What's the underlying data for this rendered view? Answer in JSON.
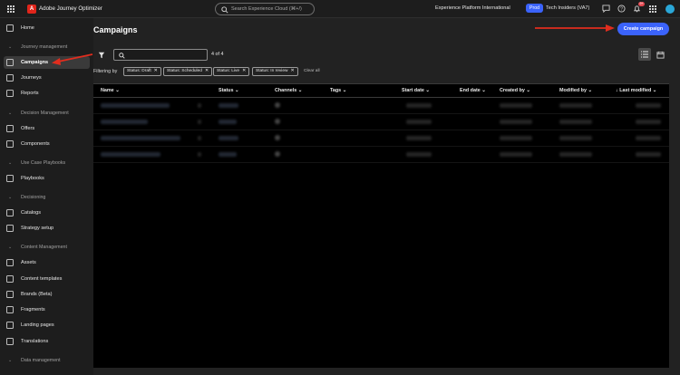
{
  "topbar": {
    "app_title": "Adobe Journey Optimizer",
    "search_placeholder": "Search Experience Cloud (⌘+/)",
    "org": "Experience Platform International",
    "env": "Prod",
    "tenant": "Tech Insiders (VA7)",
    "notification_count": "9+"
  },
  "sidebar": {
    "home": "Home",
    "sec_journey": "Journey management",
    "campaigns": "Campaigns",
    "journeys": "Journeys",
    "reports": "Reports",
    "sec_decision_mgmt": "Decision Management",
    "offers": "Offers",
    "components": "Components",
    "sec_playbooks": "Use Case Playbooks",
    "playbooks": "Playbooks",
    "sec_decisioning": "Decisioning",
    "catalogs": "Catalogs",
    "strategy": "Strategy setup",
    "sec_content": "Content Management",
    "assets": "Assets",
    "templates": "Content templates",
    "brands": "Brands (Beta)",
    "fragments": "Fragments",
    "landing": "Landing pages",
    "translations": "Translations",
    "sec_data": "Data management"
  },
  "main": {
    "title": "Campaigns",
    "create_button": "Create campaign",
    "result_count": "4 of 4",
    "filtering_by": "Filtering by",
    "filters": [
      "Status: Draft",
      "Status: Scheduled",
      "Status: Live",
      "Status: In review"
    ],
    "clear_all": "Clear all",
    "columns": [
      "Name",
      "Status",
      "Channels",
      "Tags",
      "Start date",
      "End date",
      "Created by",
      "Modified by",
      "Last modified"
    ]
  }
}
